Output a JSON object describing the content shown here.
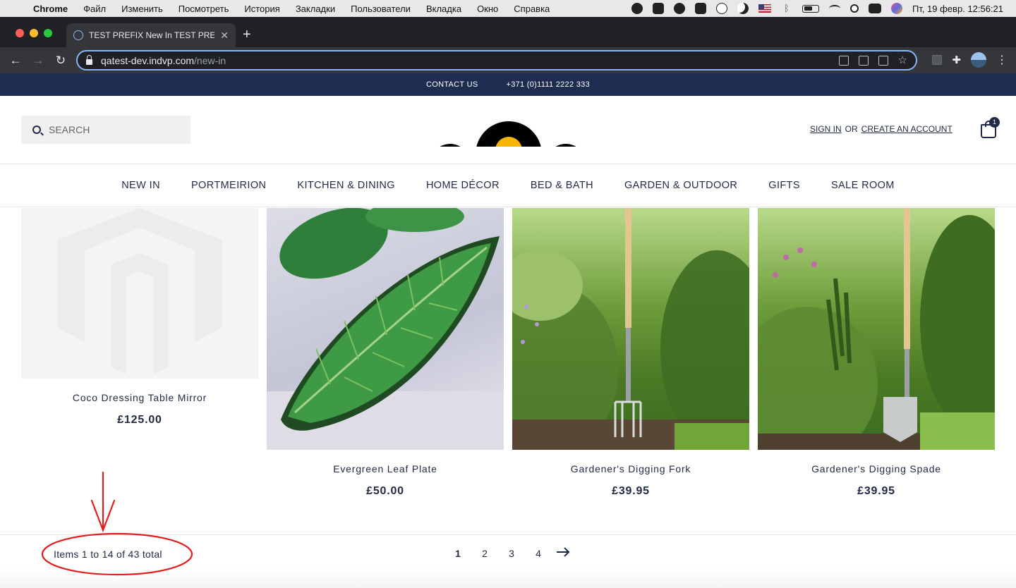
{
  "menubar": {
    "app": "Chrome",
    "items": [
      "Файл",
      "Изменить",
      "Посмотреть",
      "История",
      "Закладки",
      "Пользователи",
      "Вкладка",
      "Окно",
      "Справка"
    ],
    "clock": "Пт, 19 февр.  12:56:21"
  },
  "browser": {
    "tab_title": "TEST PREFIX New In TEST PREFIX",
    "url_host": "qatest-dev.indvp.com",
    "url_path": "/new-in"
  },
  "topbar": {
    "contact": "CONTACT US",
    "phone": "+371 (0)1111 2222 333"
  },
  "header": {
    "search_placeholder": "SEARCH",
    "sign_in": "SIGN IN",
    "or": "OR",
    "create_account": "CREATE AN ACCOUNT",
    "cart_count": "1"
  },
  "nav": [
    "NEW IN",
    "PORTMEIRION",
    "KITCHEN & DINING",
    "HOME DÉCOR",
    "BED & BATH",
    "GARDEN & OUTDOOR",
    "GIFTS",
    "SALE ROOM"
  ],
  "products": [
    {
      "name": "Coco Dressing Table Mirror",
      "price": "£125.00"
    },
    {
      "name": "Evergreen Leaf Plate",
      "price": "£50.00"
    },
    {
      "name": "Gardener's Digging Fork",
      "price": "£39.95"
    },
    {
      "name": "Gardener's Digging Spade",
      "price": "£39.95"
    }
  ],
  "toolbar": {
    "items_total": "Items 1 to 14 of 43 total",
    "pages": [
      "1",
      "2",
      "3",
      "4"
    ],
    "current_page": "1",
    "next_icon": "arrow-right-icon"
  },
  "annotation": {
    "color": "#e02020"
  }
}
